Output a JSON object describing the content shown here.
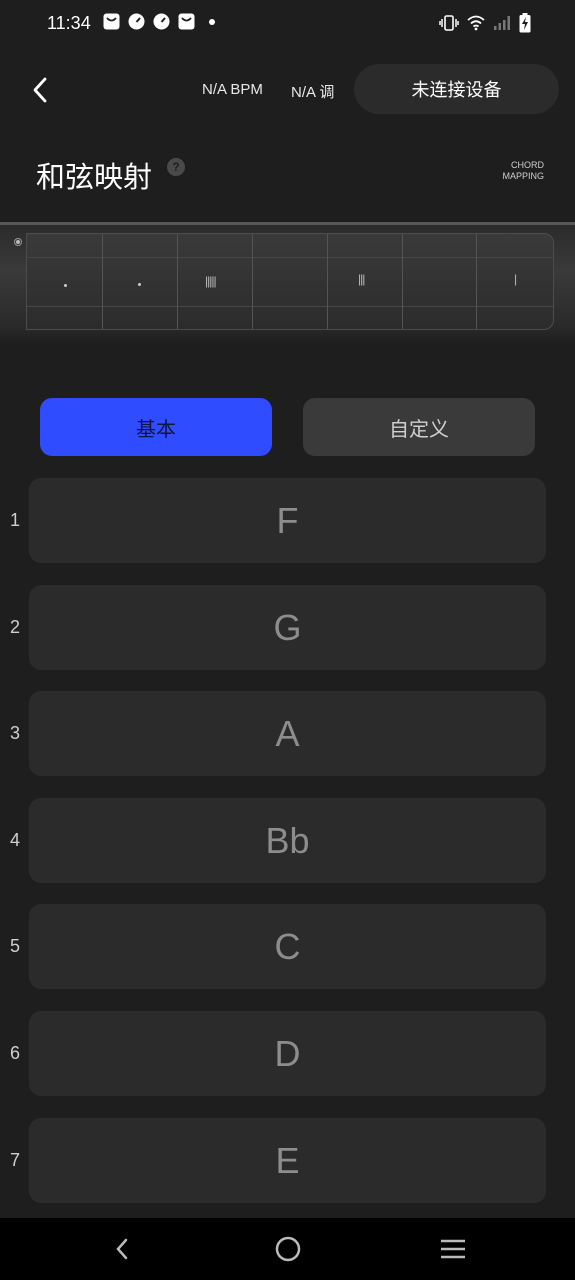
{
  "status_bar": {
    "time": "11:34",
    "notifications": [
      "bag-icon",
      "speedometer-icon",
      "speedometer-icon",
      "bag-icon",
      "dot-icon"
    ],
    "system_icons": [
      "vibrate-icon",
      "wifi-icon",
      "signal-icon",
      "battery-charging-icon"
    ]
  },
  "header": {
    "bpm": "N/A BPM",
    "key": "N/A 调",
    "device_button": "未连接设备"
  },
  "page": {
    "title": "和弦映射",
    "subtitle_line1": "CHORD",
    "subtitle_line2": "MAPPING"
  },
  "fretboard": {
    "marks": [
      "•",
      "•",
      "|||||",
      "|||",
      "|"
    ]
  },
  "tabs": {
    "basic": "基本",
    "custom": "自定义",
    "active": "basic",
    "active_color": "#2f4dff"
  },
  "chords": [
    {
      "num": "1",
      "name": "F"
    },
    {
      "num": "2",
      "name": "G"
    },
    {
      "num": "3",
      "name": "A"
    },
    {
      "num": "4",
      "name": "Bb"
    },
    {
      "num": "5",
      "name": "C"
    },
    {
      "num": "6",
      "name": "D"
    },
    {
      "num": "7",
      "name": "E"
    }
  ],
  "nav": [
    "back-icon",
    "home-icon",
    "recents-icon"
  ]
}
